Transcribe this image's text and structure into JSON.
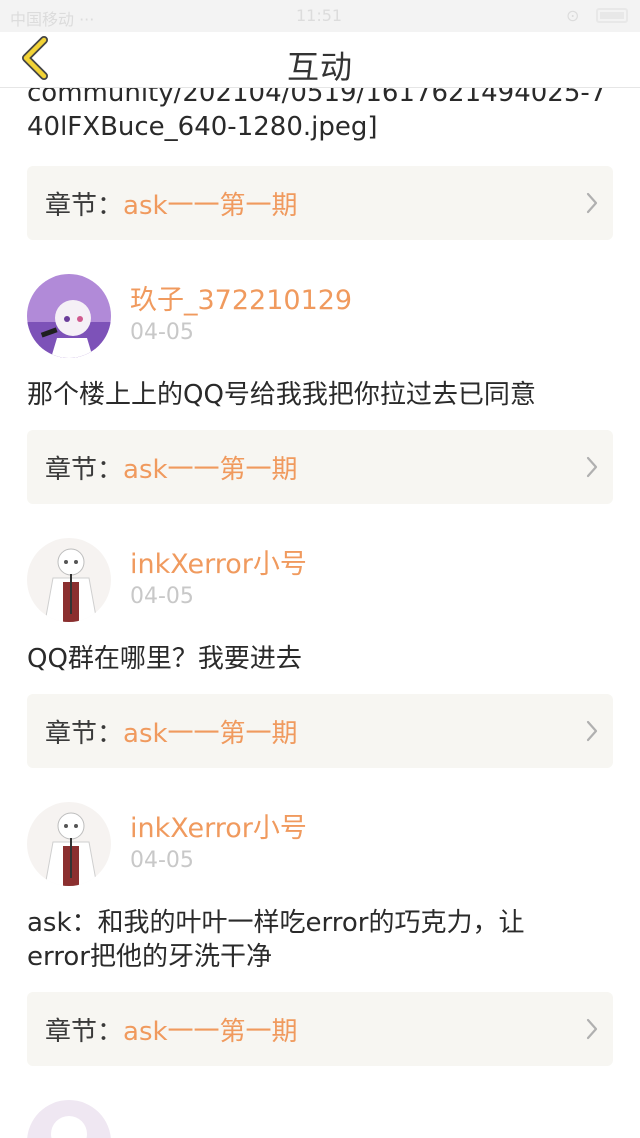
{
  "status_bar": {
    "carrier": "中国移动 ···",
    "time": "11:51",
    "battery": "⊙"
  },
  "nav": {
    "title": "互动",
    "back_icon": "chevron-left-icon"
  },
  "colors": {
    "accent": "#f09a5e",
    "back_icon": "#f2d336",
    "chapter_bg": "#f7f6f2",
    "date": "#c8c8c8"
  },
  "posts": [
    {
      "text_lines": [
        "community/202104/0519/1617621494025-7",
        "40lFXBuce_640-1280.jpeg]"
      ],
      "chapter": {
        "prefix": "章节：",
        "name": "ask一一第一期"
      }
    },
    {
      "user": {
        "name": "玖子_372210129",
        "date": "04-05"
      },
      "text": "那个楼上上的QQ号给我我把你拉过去已同意",
      "chapter": {
        "prefix": "章节：",
        "name": "ask一一第一期"
      }
    },
    {
      "user": {
        "name": "inkXerror小号",
        "date": "04-05"
      },
      "text": "QQ群在哪里？我要进去",
      "chapter": {
        "prefix": "章节：",
        "name": "ask一一第一期"
      }
    },
    {
      "user": {
        "name": "inkXerror小号",
        "date": "04-05"
      },
      "text_lines": [
        "ask：和我的叶叶一样吃error的巧克力，让",
        "error把他的牙洗干净"
      ],
      "chapter": {
        "prefix": "章节：",
        "name": "ask一一第一期"
      }
    }
  ]
}
